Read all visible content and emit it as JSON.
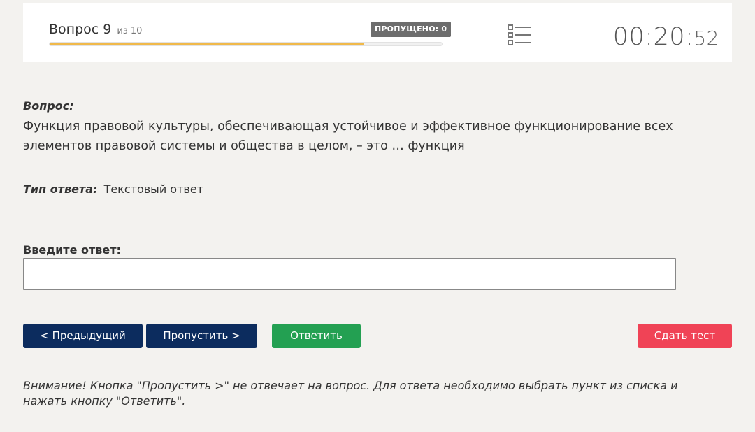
{
  "header": {
    "question_prefix": "Вопрос 9",
    "question_of": "из 10",
    "skipped_label": "ПРОПУЩЕНО: 0",
    "progress_fraction": 0.8,
    "timer_main": "00:20:",
    "timer_seconds": "52",
    "colors": {
      "progress": "#f0b94a"
    }
  },
  "question": {
    "title": "Вопрос:",
    "text": "Функция правовой культуры, обеспечивающая устойчивое и эффективное функционирование всех элементов правовой системы и общества в целом, – это … функция"
  },
  "answer_type": {
    "label": "Тип ответа:",
    "value": "Текстовый ответ"
  },
  "answer": {
    "label": "Введите ответ:",
    "value": "",
    "placeholder": ""
  },
  "buttons": {
    "prev": "< Предыдущий",
    "skip": "Пропустить >",
    "answer": "Ответить",
    "submit": "Сдать тест",
    "colors": {
      "nav": "#0c2c5e",
      "answer": "#23a052",
      "submit": "#f04356"
    }
  },
  "warning": "Внимание! Кнопка \"Пропустить >\" не отвечает на вопрос. Для ответа необходимо выбрать пункт из списка и нажать кнопку \"Ответить\"."
}
